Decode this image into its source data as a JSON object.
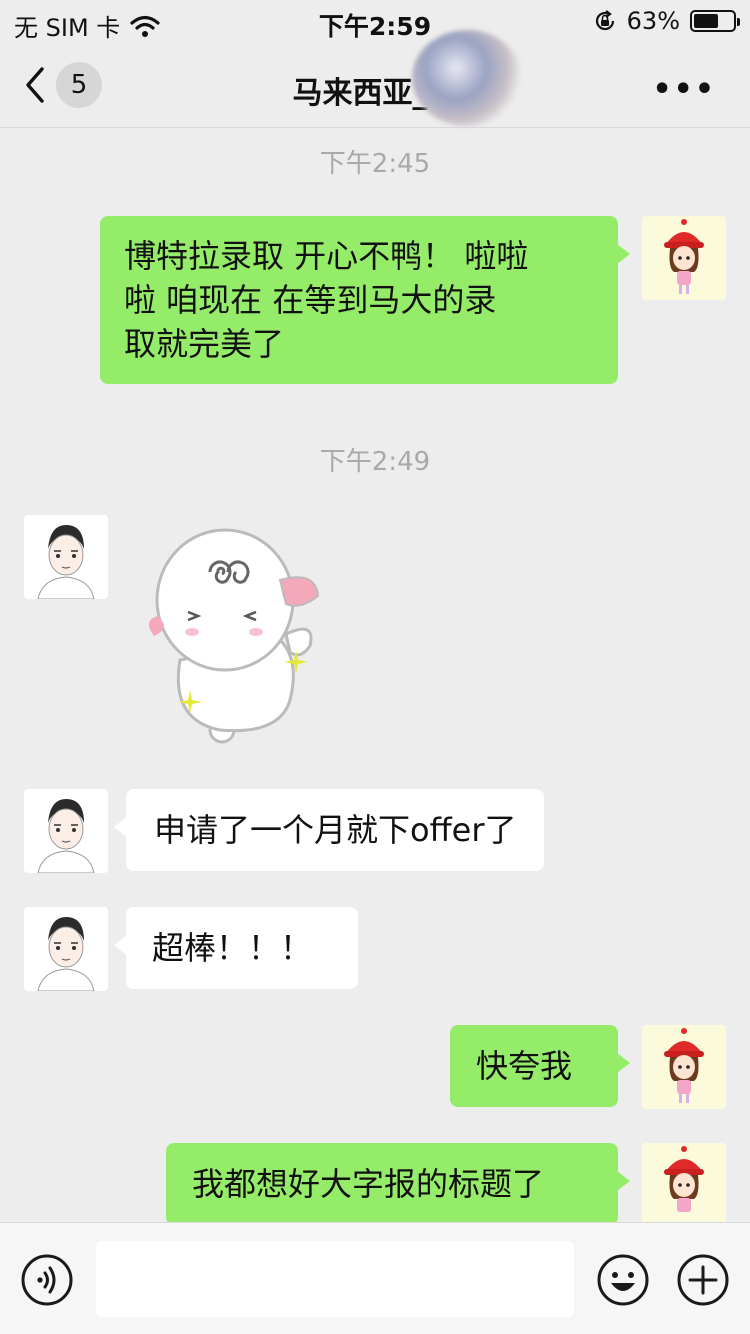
{
  "status_bar": {
    "carrier": "无 SIM 卡",
    "time": "下午2:59",
    "battery_percent": "63%",
    "battery_level": 0.63,
    "icons": [
      "wifi-icon",
      "rotation-lock-icon",
      "battery-icon"
    ]
  },
  "nav": {
    "back_badge": "5",
    "title": "马来西亚_袁",
    "more_label": "•••"
  },
  "messages": [
    {
      "type": "timestamp",
      "text": "下午2:45"
    },
    {
      "type": "text",
      "side": "right",
      "lines": [
        "博特拉录取 开心不鸭！  啦啦",
        "啦  咱现在 在等到马大的录",
        "取就完美了"
      ]
    },
    {
      "type": "timestamp",
      "text": "下午2:49"
    },
    {
      "type": "sticker",
      "side": "left",
      "sticker": "dizzy-sheep-sticker"
    },
    {
      "type": "text",
      "side": "left",
      "text": "申请了一个月就下offer了"
    },
    {
      "type": "text",
      "side": "left",
      "text": "超棒！！！"
    },
    {
      "type": "text",
      "side": "right",
      "text": "快夸我"
    },
    {
      "type": "text",
      "side": "right",
      "text": "我都想好大字报的标题了"
    }
  ],
  "input_bar": {
    "voice_icon": "voice-icon",
    "input_value": "",
    "emoji_icon": "emoji-icon",
    "plus_icon": "plus-icon"
  },
  "colors": {
    "background": "#ededed",
    "green_bubble": "#95ec69",
    "white_bubble": "#ffffff",
    "timestamp": "#a9a9a9"
  }
}
